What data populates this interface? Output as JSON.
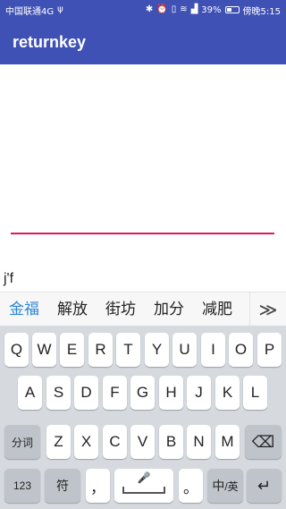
{
  "status_bar": {
    "carrier": "中国联通4G",
    "signal_text": "ψ",
    "icons_right": [
      "bluetooth-icon",
      "alarm-icon",
      "vibrate-icon",
      "wifi-icon",
      "signal-icon"
    ],
    "battery_percent": "39%",
    "battery_level": 0.39,
    "time": "傍晚5:15"
  },
  "app_bar": {
    "title": "returnkey"
  },
  "edit_text": {
    "value": ""
  },
  "composing_text": "j'f",
  "candidates": [
    "金福",
    "解放",
    "街坊",
    "加分",
    "减肥"
  ],
  "candidate_more": "≫",
  "keyboard": {
    "row1": [
      "Q",
      "W",
      "E",
      "R",
      "T",
      "Y",
      "U",
      "I",
      "O",
      "P"
    ],
    "row2": [
      "A",
      "S",
      "D",
      "F",
      "G",
      "H",
      "J",
      "K",
      "L"
    ],
    "row3": [
      "Z",
      "X",
      "C",
      "V",
      "B",
      "N",
      "M"
    ],
    "fenci": "分词",
    "backspace_icon": "⌫",
    "num_key": "123",
    "symbol_key": "符",
    "comma_key": "，",
    "space_mic": "🎤",
    "period_key": "。",
    "lang_key": "中",
    "lang_sub": "/英",
    "enter_icon": "↵"
  },
  "colors": {
    "primary": "#3f51b5",
    "accent": "#d81b60",
    "candidate_highlight": "#2d86d8",
    "keyboard_bg": "#d6d9de"
  }
}
